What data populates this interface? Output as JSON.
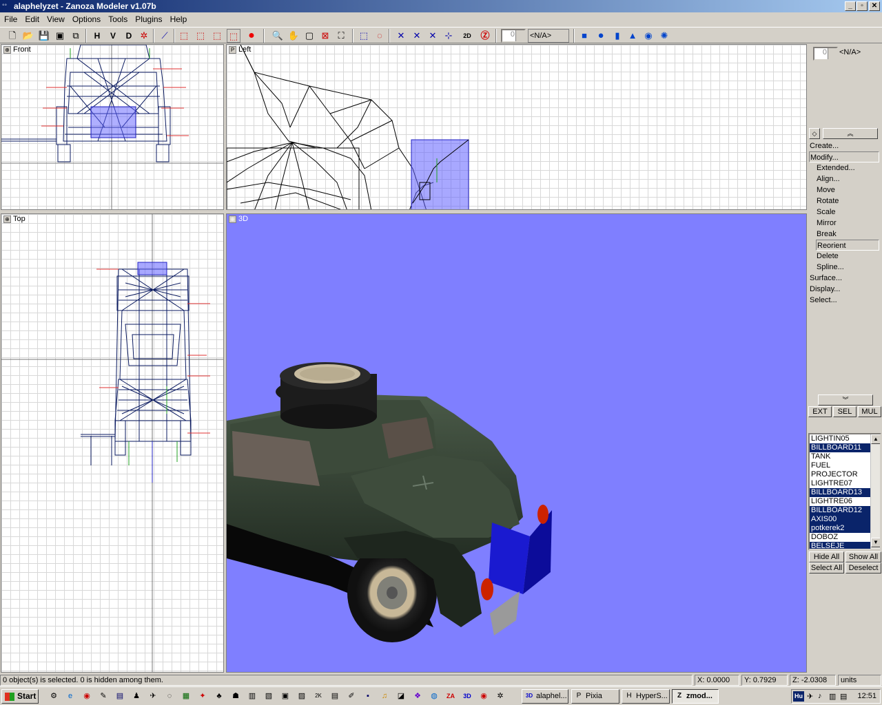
{
  "window": {
    "title": "alaphelyzet - Zanoza Modeler v1.07b",
    "min": "_",
    "max": "▫",
    "close": "✕"
  },
  "menu": [
    "File",
    "Edit",
    "View",
    "Options",
    "Tools",
    "Plugins",
    "Help"
  ],
  "toolbar": {
    "view_h": "H",
    "view_v": "V",
    "view_d": "D",
    "spin_value": "0",
    "combo_value": "<N/A>",
    "icons": [
      "new-icon",
      "open-icon",
      "save-icon",
      "save-as-icon",
      "import-icon",
      "wireframe-icon",
      "cube-icon",
      "cube-solid-icon",
      "cube-textured-icon",
      "cube-red-icon",
      "sphere-red-icon",
      "zoom-icon",
      "pan-hand-icon",
      "box-view-icon",
      "zoom-region-icon",
      "select-region-icon",
      "select-rect-icon",
      "select-circle-icon",
      "move-axis-icon",
      "rotate-axis-icon",
      "scale-axis-icon",
      "axis-icon",
      "convert-2d-3d-icon",
      "zanoza-icon",
      "box-primitive-icon",
      "sphere-primitive-icon",
      "cylinder-primitive-icon",
      "cone-primitive-icon",
      "torus-primitive-icon",
      "gear-primitive-icon"
    ]
  },
  "viewports": {
    "front": {
      "label": "Front"
    },
    "left": {
      "label": "Left"
    },
    "top": {
      "label": "Top"
    },
    "perspective": {
      "label": "3D",
      "background": "#7f7fff"
    }
  },
  "rightpanel": {
    "spin_value": "0",
    "combo_value": "<N/A>",
    "menu": [
      {
        "label": "Create...",
        "indent": false,
        "selected": false
      },
      {
        "label": "Modify...",
        "indent": false,
        "selected": true
      },
      {
        "label": "Extended...",
        "indent": true,
        "selected": false
      },
      {
        "label": "Align...",
        "indent": true,
        "selected": false
      },
      {
        "label": "Move",
        "indent": true,
        "selected": false
      },
      {
        "label": "Rotate",
        "indent": true,
        "selected": false
      },
      {
        "label": "Scale",
        "indent": true,
        "selected": false
      },
      {
        "label": "Mirror",
        "indent": true,
        "selected": false
      },
      {
        "label": "Break",
        "indent": true,
        "selected": false
      },
      {
        "label": "Reorient",
        "indent": true,
        "selected": true
      },
      {
        "label": "Delete",
        "indent": true,
        "selected": false
      },
      {
        "label": "Spline...",
        "indent": true,
        "selected": false
      },
      {
        "label": "Surface...",
        "indent": false,
        "selected": false
      },
      {
        "label": "Display...",
        "indent": false,
        "selected": false
      },
      {
        "label": "Select...",
        "indent": false,
        "selected": false
      }
    ],
    "tabs": [
      "EXT",
      "SEL",
      "MUL"
    ],
    "objects": [
      {
        "name": "LIGHTIN05",
        "selected": false
      },
      {
        "name": "BILLBOARD11",
        "selected": true
      },
      {
        "name": "TANK",
        "selected": false
      },
      {
        "name": "FUEL",
        "selected": false
      },
      {
        "name": "PROJECTOR",
        "selected": false
      },
      {
        "name": "LIGHTRE07",
        "selected": false
      },
      {
        "name": "BILLBOARD13",
        "selected": true
      },
      {
        "name": "LIGHTRE06",
        "selected": false
      },
      {
        "name": "BILLBOARD12",
        "selected": true
      },
      {
        "name": "AXIS00",
        "selected": true
      },
      {
        "name": "potkerek2",
        "selected": true
      },
      {
        "name": "DOBOZ",
        "selected": false
      },
      {
        "name": "BELSEJE",
        "selected": true
      }
    ],
    "hide_all": "Hide All",
    "show_all": "Show All",
    "select_all": "Select All",
    "deselect": "Deselect"
  },
  "status": {
    "message": "0 object(s) is selected. 0 is hidden among them.",
    "x": "X: 0.0000",
    "y": "Y: 0.7929",
    "z": "Z: -2.0308",
    "units": "units"
  },
  "taskbar": {
    "start": "Start",
    "tasks": [
      {
        "label": "alaphel...",
        "icon": "3D",
        "active": false
      },
      {
        "label": "Pixia",
        "icon": "P",
        "active": false
      },
      {
        "label": "HyperS...",
        "icon": "H",
        "active": false
      },
      {
        "label": "zmod...",
        "icon": "Z",
        "active": true
      }
    ],
    "lang": "Hu",
    "clock": "12:51"
  }
}
